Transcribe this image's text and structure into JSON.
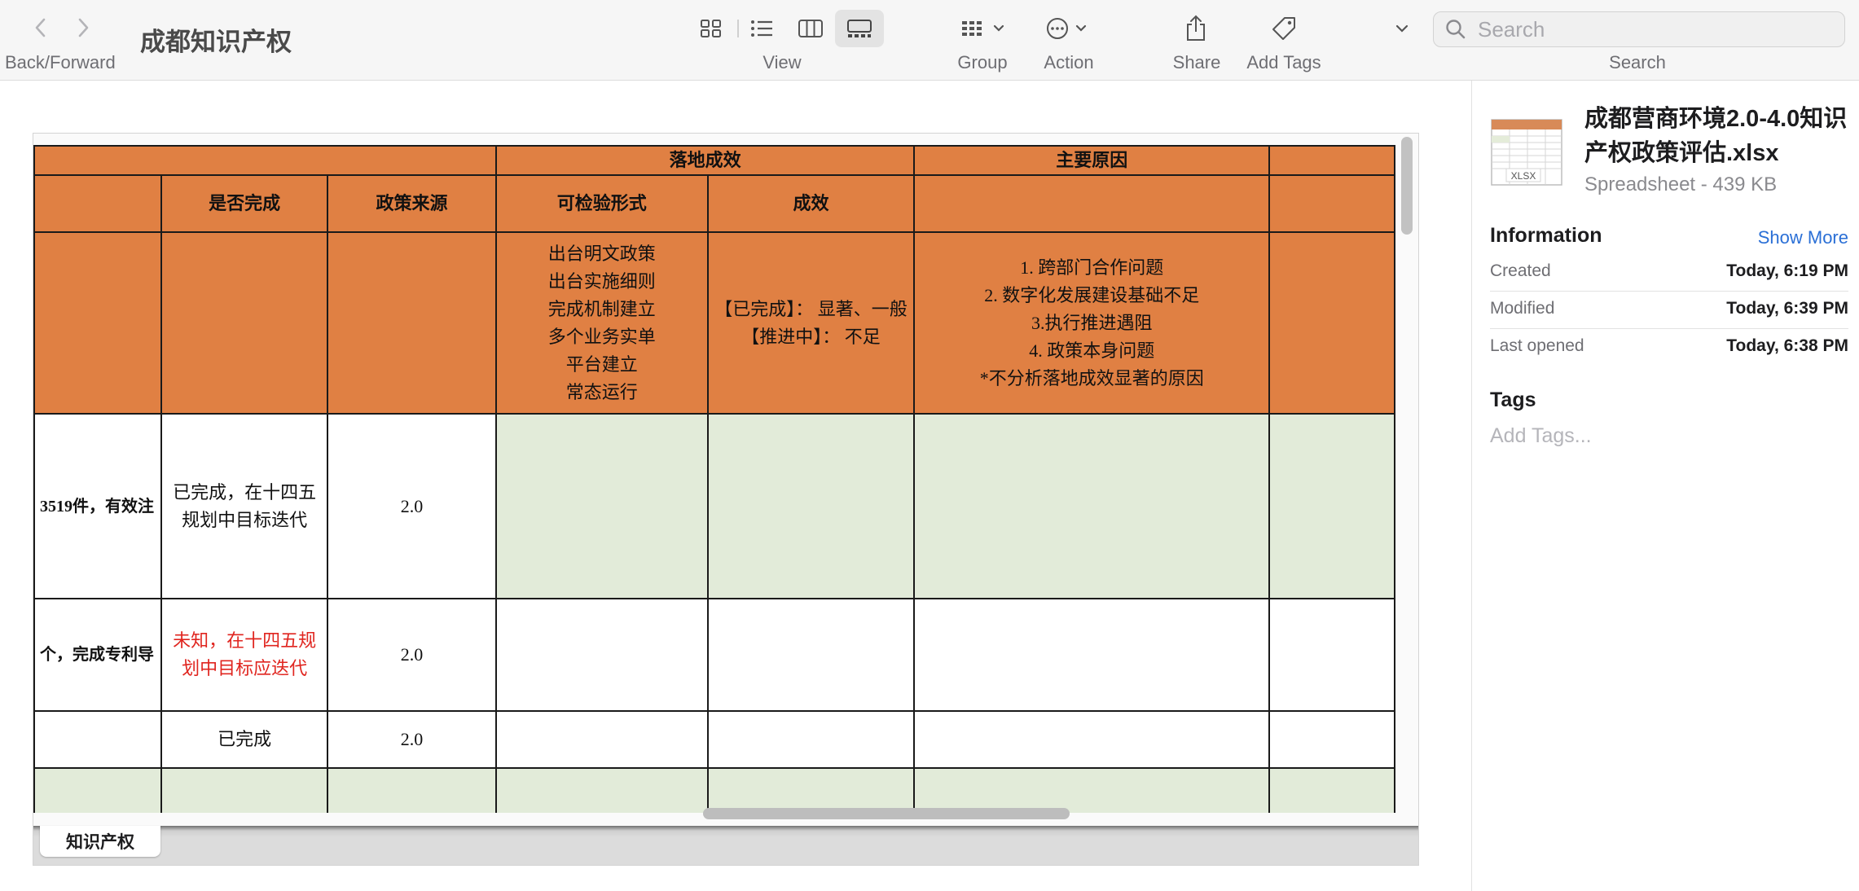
{
  "toolbar": {
    "back_forward_label": "Back/Forward",
    "title": "成都知识产权",
    "view_label": "View",
    "group_label": "Group",
    "action_label": "Action",
    "share_label": "Share",
    "add_tags_label": "Add Tags",
    "search_label": "Search",
    "search_placeholder": "Search"
  },
  "sheet": {
    "tab_name": "知识产权",
    "header_groups": {
      "landing": "落地成效",
      "reasons": "主要原因"
    },
    "columns": {
      "complete": "是否完成",
      "source": "政策来源",
      "verifiable": "可检验形式",
      "effect": "成效"
    },
    "header_notes": {
      "verifiable": [
        "出台明文政策",
        "出台实施细则",
        "完成机制建立",
        "多个业务实单",
        "平台建立",
        "常态运行"
      ],
      "effect": [
        "【已完成】： 显著、一般",
        "【推进中】： 不足"
      ],
      "reasons": [
        "1. 跨部门合作问题",
        "2. 数字化发展建设基础不足",
        "3.执行推进遇阻",
        "4. 政策本身问题",
        "*不分析落地成效显著的原因"
      ]
    },
    "rows": [
      {
        "partial": "3519件，有效注",
        "complete": "已完成，在十四五规划中目标迭代",
        "source": "2.0"
      },
      {
        "partial": "个，完成专利导",
        "complete": "未知，在十四五规划中目标应迭代",
        "source": "2.0"
      },
      {
        "partial": "",
        "complete": "已完成",
        "source": "2.0"
      }
    ]
  },
  "inspector": {
    "file_name": "成都营商环境2.0-4.0知识产权政策评估.xlsx",
    "file_kind": "Spreadsheet - 439 KB",
    "thumb_badge": "XLSX",
    "info_title": "Information",
    "show_more": "Show More",
    "info": [
      {
        "key": "Created",
        "value": "Today, 6:19 PM"
      },
      {
        "key": "Modified",
        "value": "Today, 6:39 PM"
      },
      {
        "key": "Last opened",
        "value": "Today, 6:38 PM"
      }
    ],
    "tags_title": "Tags",
    "add_tags_placeholder": "Add Tags..."
  },
  "colors": {
    "header_orange": "#e08043",
    "row_green": "#e2ebd9",
    "warning_red": "#e0251f",
    "link_blue": "#2a6fd6"
  }
}
